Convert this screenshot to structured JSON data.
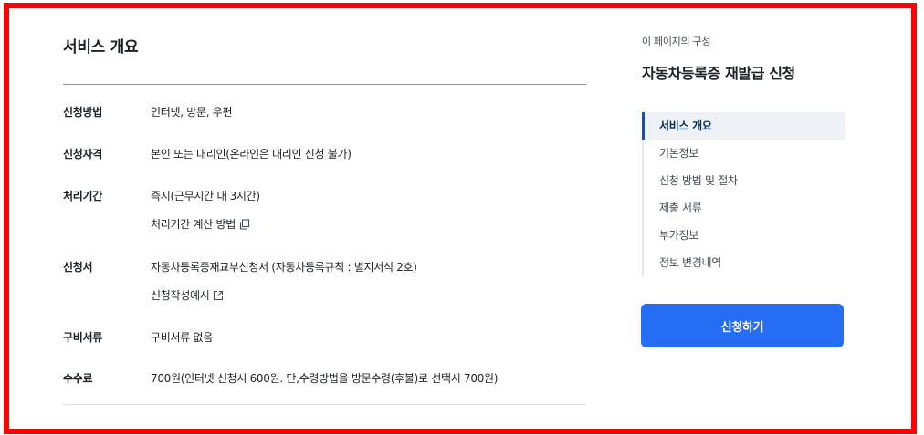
{
  "main": {
    "section_title": "서비스 개요",
    "rows": [
      {
        "label": "신청방법",
        "value": "인터넷, 방문, 우편"
      },
      {
        "label": "신청자격",
        "value": "본인 또는 대리인(온라인은 대리인 신청 불가)"
      },
      {
        "label": "처리기간",
        "value": "즉시(근무시간 내 3시간)",
        "link": "처리기간 계산 방법",
        "link_icon": "copy-icon"
      },
      {
        "label": "신청서",
        "value": "자동차등록증재교부신청서 (자동차등록규칙 : 별지서식 2호)",
        "link": "신청작성예시",
        "link_icon": "external-link-icon"
      },
      {
        "label": "구비서류",
        "value": "구비서류 없음"
      },
      {
        "label": "수수료",
        "value": "700원(인터넷 신청시 600원. 단,수령방법을 방문수령(후불)로 선택시 700원)"
      }
    ]
  },
  "sidebar": {
    "caption": "이 페이지의 구성",
    "title": "자동차등록증 재발급 신청",
    "items": [
      {
        "label": "서비스 개요",
        "active": true
      },
      {
        "label": "기본정보",
        "active": false
      },
      {
        "label": "신청 방법 및 절차",
        "active": false
      },
      {
        "label": "제출 서류",
        "active": false
      },
      {
        "label": "부가정보",
        "active": false
      },
      {
        "label": "정보 변경내역",
        "active": false
      }
    ],
    "apply_button": "신청하기"
  },
  "colors": {
    "frame": "#ff0000",
    "primary": "#256ef4",
    "active_indicator": "#0b50d0",
    "active_bg": "#eef2f7"
  }
}
